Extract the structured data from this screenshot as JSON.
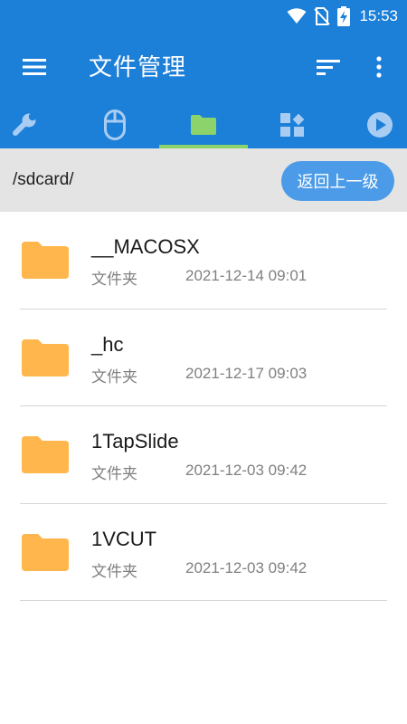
{
  "status": {
    "time": "15:53"
  },
  "app": {
    "title": "文件管理"
  },
  "tabs": [
    {
      "icon": "wrench-icon"
    },
    {
      "icon": "mouse-icon"
    },
    {
      "icon": "folder-icon",
      "active": true
    },
    {
      "icon": "apps-icon"
    },
    {
      "icon": "play-icon"
    }
  ],
  "path": {
    "current": "/sdcard/",
    "back_label": "返回上一级"
  },
  "files": [
    {
      "name": "__MACOSX",
      "type": "文件夹",
      "date": "2021-12-14 09:01"
    },
    {
      "name": "_hc",
      "type": "文件夹",
      "date": "2021-12-17 09:03"
    },
    {
      "name": "1TapSlide",
      "type": "文件夹",
      "date": "2021-12-03 09:42"
    },
    {
      "name": "1VCUT",
      "type": "文件夹",
      "date": "2021-12-03 09:42"
    }
  ],
  "colors": {
    "primary": "#1c7fd8",
    "tab_indicator": "#8bd36a",
    "button": "#4c9be8",
    "folder": "#ffb74d",
    "pathbar": "#e4e4e4"
  }
}
